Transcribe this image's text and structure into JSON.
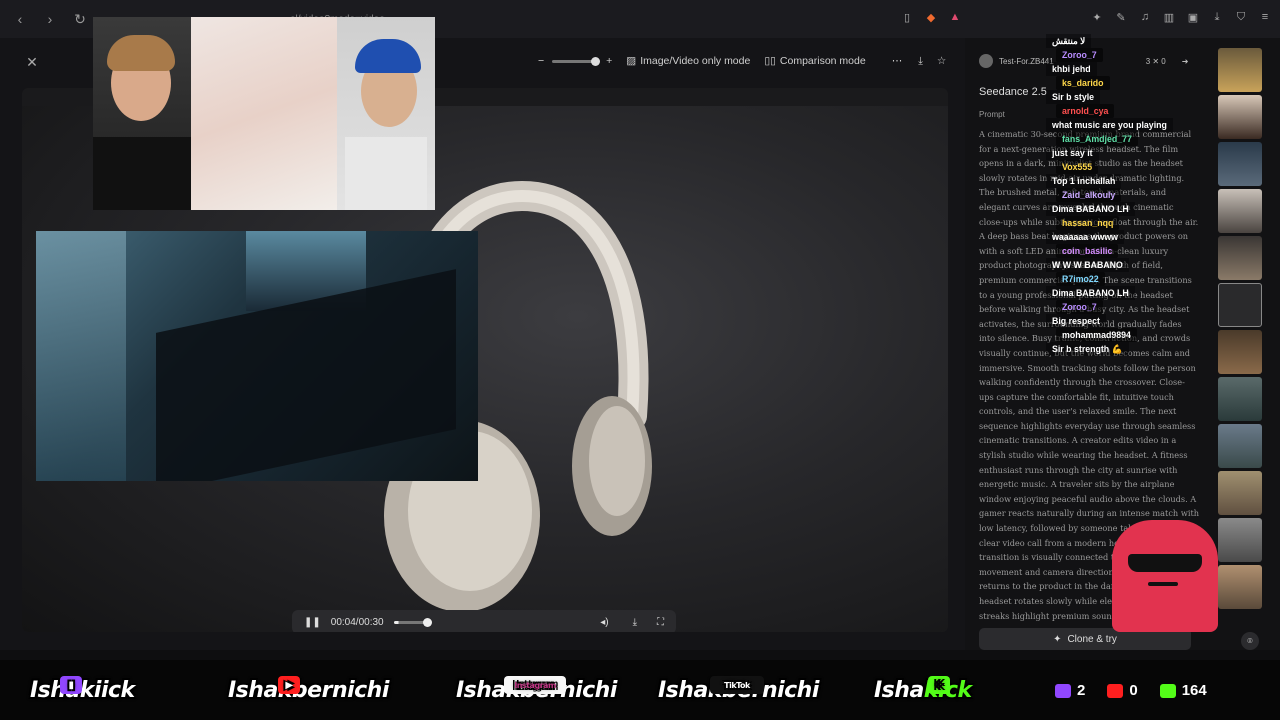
{
  "browser": {
    "url": "…el/video?mode=video"
  },
  "toolbar": {
    "zoom_minus": "−",
    "zoom_plus": "+",
    "image_video_mode": "Image/Video only mode",
    "comparison_mode": "Comparison mode"
  },
  "player": {
    "time": "00:04/00:30",
    "progress": 0.13
  },
  "panel": {
    "user": "Test-For.ZB441",
    "stats": "3 ✕ 0",
    "model": "Seedance 2.5",
    "prompt_label": "Prompt",
    "prompt_text": "A cinematic 30-second premium brand commercial for a next-generation wireless headset. The film opens in a dark, minimalist studio as the headset slowly rotates in mid-air under dramatic lighting. The brushed metal, soft-touch materials, and elegant curves are revealed through cinematic close-ups while subtle particles float through the air. A deep bass beat begins as the product powers on with a soft LED animation. Ultra-clean luxury product photography, shallow depth of field, premium commercial quality. The scene transitions to a young professional putting on the headset before walking through a busy city. As the headset activates, the surrounding world gradually fades into silence. Busy traffic, construction, and crowds visually continue, but the world becomes calm and immersive. Smooth tracking shots follow the person walking confidently through the crossover. Close-ups capture the comfortable fit, intuitive touch controls, and the user's relaxed smile. The next sequence highlights everyday use through seamless cinematic transitions. A creator edits video in a stylish studio while wearing the headset. A fitness enthusiast runs through the city at sunrise with energetic music. A traveler sits by the airplane window enjoying peaceful audio above the clouds. A gamer reacts naturally during an intense match with low latency, followed by someone taking a crystal-clear video call from a modern home office. Each transition is visually connected through matching movement and camera direction. The final sequence returns to the product in the dark studio. The headset rotates slowly while elegant graphical light streaks highlight premium sound, active noise cancellation, long battery life, and wireless freedom without distraction.",
    "clone_label": "Clone & try"
  },
  "chat": [
    {
      "user": "",
      "msg": "لا منتقش",
      "color": "#ffffff"
    },
    {
      "user": "Zoroo_7",
      "msg": "khbi jehd",
      "color": "#b98cff"
    },
    {
      "user": "ks_darido",
      "msg": "Sir b style",
      "color": "#ffd84a"
    },
    {
      "user": "arnold_cya",
      "msg": "what music are you playing",
      "color": "#ff5050"
    },
    {
      "user": "fans_Amdjed_77",
      "msg": "just say it",
      "color": "#5fe0a8"
    },
    {
      "user": "Vox555",
      "msg": "Top 1 inchallah",
      "color": "#ffd84a"
    },
    {
      "user": "Zaid_alkouly",
      "msg": "Dima BABANO LH",
      "color": "#c9a8ff"
    },
    {
      "user": "hassan_nqq",
      "msg": "waaaaaa wwww",
      "color": "#ffd84a"
    },
    {
      "user": "coin_basilic",
      "msg": "W W W BABANO",
      "color": "#d48cff"
    },
    {
      "user": "R7imo22",
      "msg": "Dima BABANO LH",
      "color": "#7fd8ff"
    },
    {
      "user": "Zoroo_7",
      "msg": "Big respect",
      "color": "#b98cff"
    },
    {
      "user": "mohammad9894",
      "msg": "Sir b strength 💪",
      "color": "#ffffff"
    }
  ],
  "banner": {
    "twitch": "Ishakiick",
    "youtube": "Ishakbernichi",
    "instagram": "Ishakbernichi",
    "instagram_tag": "Instagram",
    "tiktok": "Ishakbernichi",
    "tiktok_tag": "TikTok",
    "kick_prefix": "Isha",
    "kick_suffix": "kick",
    "twitch_count": "2",
    "youtube_count": "0",
    "kick_count": "164"
  },
  "colors": {
    "twitch": "#9147ff",
    "youtube": "#ff1f1f",
    "kick": "#53fc18",
    "ghost": "#e2334f"
  }
}
